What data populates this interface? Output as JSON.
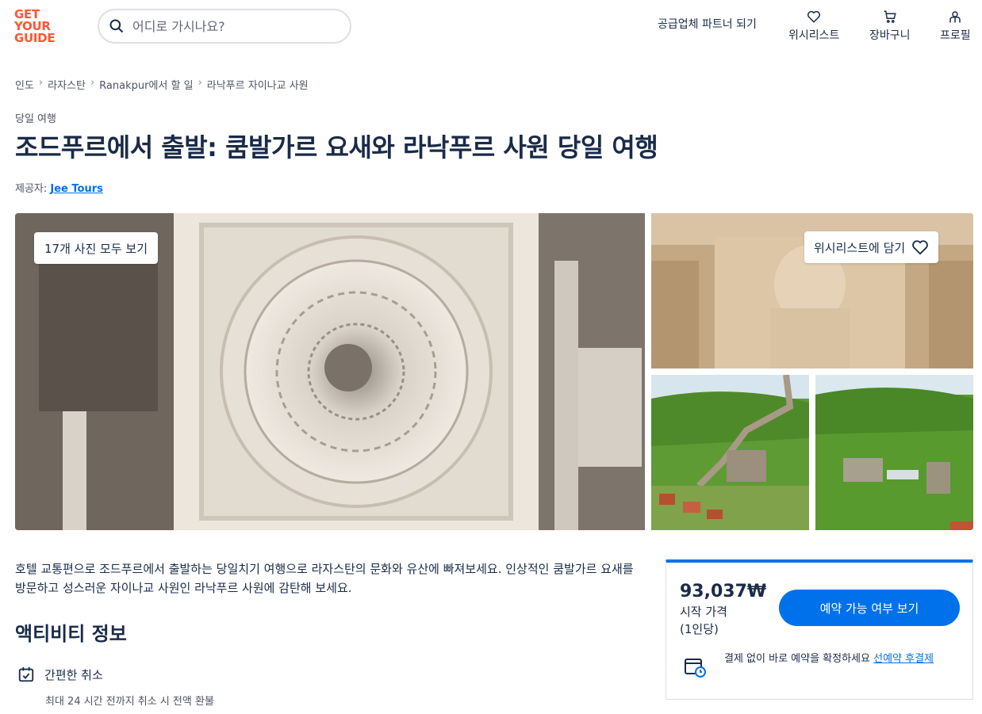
{
  "header": {
    "logo_lines": [
      "GET",
      "YOUR",
      "GUIDE"
    ],
    "search_placeholder": "어디로 가시나요?",
    "partner_link": "공급업체 파트너 되기",
    "wishlist_label": "위시리스트",
    "cart_label": "장바구니",
    "profile_label": "프로필"
  },
  "breadcrumb": [
    "인도",
    "라자스탄",
    "Ranakpur에서 할 일",
    "라낙푸르 자이나교 사원"
  ],
  "breadcrumb_sep": "›",
  "category": "당일 여행",
  "title": "조드푸르에서 출발: 쿰발가르 요새와 라낙푸르 사원 당일 여행",
  "provider": {
    "prefix": "제공자:",
    "name": "Jee Tours"
  },
  "gallery": {
    "all_photos_label": "17개 사진 모두 보기",
    "wishlist_button": "위시리스트에 담기"
  },
  "description": "호텔 교통편으로 조드푸르에서 출발하는 당일치기 여행으로 라자스탄의 문화와 유산에 빠져보세요. 인상적인 쿰발가르 요새를 방문하고 성스러운 자이나교 사원인 라낙푸르 사원에 감탄해 보세요.",
  "activity_info": {
    "title": "액티비티 정보",
    "cancel_title": "간편한 취소",
    "cancel_detail": "최대 24 시간 전까지 취소 시 전액 환불"
  },
  "booking": {
    "price": "93,037₩",
    "price_from": "시작 가격",
    "price_per": "(1인당)",
    "button": "예약 가능 여부 보기",
    "reserve_text": "결제 없이 바로 예약을 확정하세요 ",
    "reserve_link": "선예약 후결제"
  },
  "colors": {
    "brand": "#ff5533",
    "accent": "#0071eb",
    "text": "#1a2b49"
  },
  "icons": [
    "search-icon",
    "heart-icon",
    "cart-icon",
    "profile-icon",
    "calendar-check-icon",
    "calendar-clock-icon"
  ]
}
